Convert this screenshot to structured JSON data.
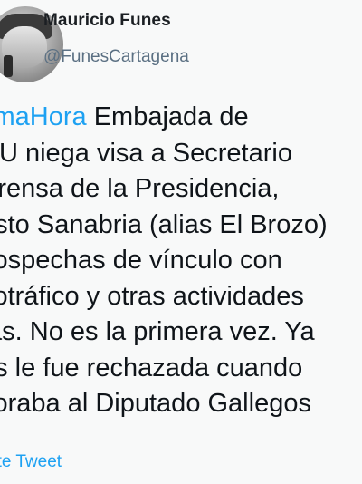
{
  "author": {
    "name": "Mauricio Funes",
    "handle": "@FunesCartagena"
  },
  "tweet": {
    "hashtag": "#UltimaHora",
    "hashtag_visible": "timaHora",
    "lines": [
      "Embajada de",
      "UU niega visa a Secretario",
      "Prensa de la Presidencia,",
      "esto Sanabria (alias El Brozo)",
      "sospechas de vínculo con",
      "cotráfico y otras actividades",
      "tas. No es la primera vez. Ya",
      "es le fue rechazada cuando",
      "soraba al Diputado Gallegos"
    ]
  },
  "translate_label": "ate Tweet",
  "colors": {
    "link": "#1da1f2",
    "handle": "#5b7083",
    "text": "#0f1419",
    "background": "#f8f9f9"
  },
  "icons": [
    "avatar-photo"
  ]
}
